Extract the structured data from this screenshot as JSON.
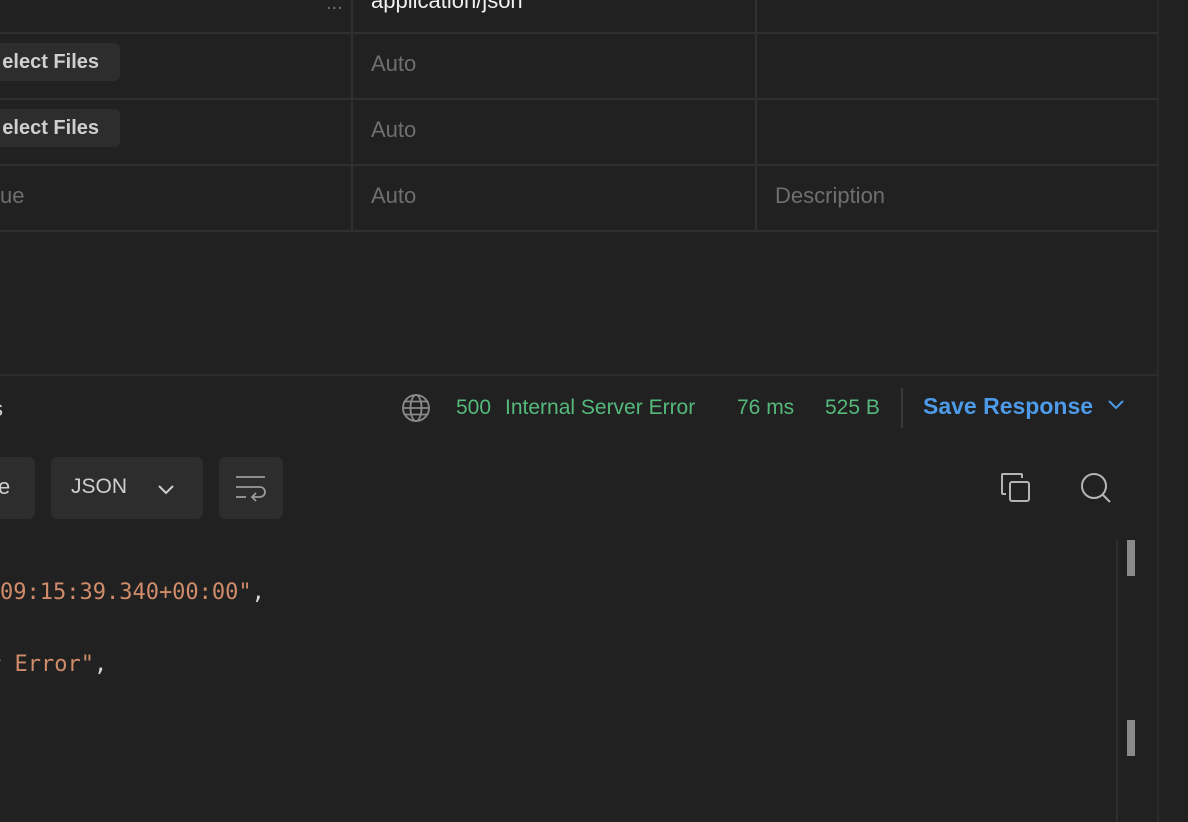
{
  "table": {
    "rows": [
      {
        "value_ellipsis": "...",
        "content_type": "application/json",
        "description": ""
      },
      {
        "value_button": "elect Files",
        "content_type": "Auto",
        "description": ""
      },
      {
        "value_button": "elect Files",
        "content_type": "Auto",
        "description": ""
      },
      {
        "value_placeholder": "ue",
        "content_type": "Auto",
        "description": "Description"
      }
    ]
  },
  "response": {
    "tab_fragment": "s",
    "status_code": "500",
    "status_text": "Internal Server Error",
    "time": "76 ms",
    "size": "525 B",
    "save_label": "Save Response"
  },
  "toolbar": {
    "left_fragment": "e",
    "format": "JSON"
  },
  "code_lines": [
    {
      "string": "09:15:39.340+00:00\"",
      "punct": ","
    },
    {
      "string": "Error\"",
      "punct": ","
    }
  ],
  "colors": {
    "background": "#212121",
    "status_green": "#55b97c",
    "accent_blue": "#4c9ae8",
    "json_string": "#d08c6a"
  },
  "icons": [
    "globe-icon",
    "chevron-down-icon",
    "wrap-lines-icon",
    "copy-icon",
    "search-icon"
  ]
}
